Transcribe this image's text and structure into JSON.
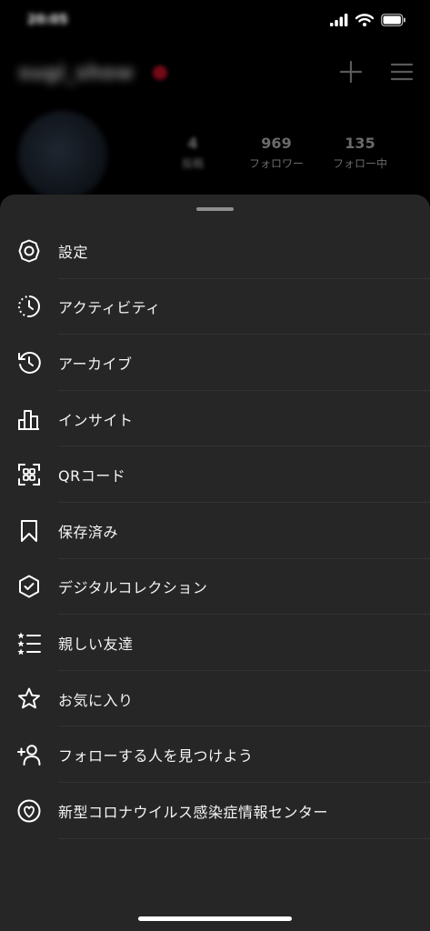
{
  "status_bar": {
    "time": "20:05",
    "icons": [
      "signal-icon",
      "wifi-icon",
      "battery-icon"
    ]
  },
  "profile": {
    "username": "sugi_show",
    "stats": [
      {
        "value": "4",
        "label": "投稿"
      },
      {
        "value": "969",
        "label": "フォロワー"
      },
      {
        "value": "135",
        "label": "フォロー中"
      }
    ],
    "header_icons": [
      "plus-icon",
      "hamburger-menu-icon"
    ]
  },
  "menu": {
    "items": [
      {
        "label": "設定",
        "icon": "gear-icon"
      },
      {
        "label": "アクティビティ",
        "icon": "activity-clock-icon"
      },
      {
        "label": "アーカイブ",
        "icon": "archive-history-icon"
      },
      {
        "label": "インサイト",
        "icon": "bar-chart-icon"
      },
      {
        "label": "QRコード",
        "icon": "qr-code-icon"
      },
      {
        "label": "保存済み",
        "icon": "bookmark-icon"
      },
      {
        "label": "デジタルコレクション",
        "icon": "verified-hexagon-icon"
      },
      {
        "label": "親しい友達",
        "icon": "close-friends-list-icon"
      },
      {
        "label": "お気に入り",
        "icon": "star-icon"
      },
      {
        "label": "フォローする人を見つけよう",
        "icon": "add-person-icon"
      },
      {
        "label": "新型コロナウイルス感染症情報センター",
        "icon": "heart-circle-icon"
      }
    ]
  },
  "colors": {
    "background": "#000000",
    "sheet": "#262626",
    "divider": "#333333",
    "text": "#f5f5f5",
    "muted": "#6a6a6a",
    "live_red": "#c21027"
  }
}
